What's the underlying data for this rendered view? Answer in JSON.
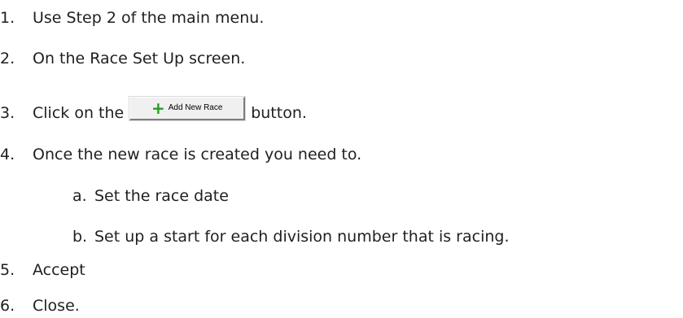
{
  "steps": [
    {
      "num": "1.",
      "text": "Use Step 2 of the main menu."
    },
    {
      "num": "2.",
      "text": "On the Race Set Up screen."
    },
    {
      "num": "3.",
      "text_before": "Click on the",
      "text_after": "button."
    },
    {
      "num": "4.",
      "text": "Once the new race is created you need to."
    },
    {
      "num": "a.",
      "text": "Set the race date"
    },
    {
      "num": "b.",
      "text": "Set up a start for each division number that is racing."
    },
    {
      "num": "5.",
      "text": "Accept"
    },
    {
      "num": "6.",
      "text": "Close."
    }
  ],
  "button": {
    "icon": "plus-icon",
    "label": "Add New Race",
    "icon_color": "#1aa31a"
  }
}
